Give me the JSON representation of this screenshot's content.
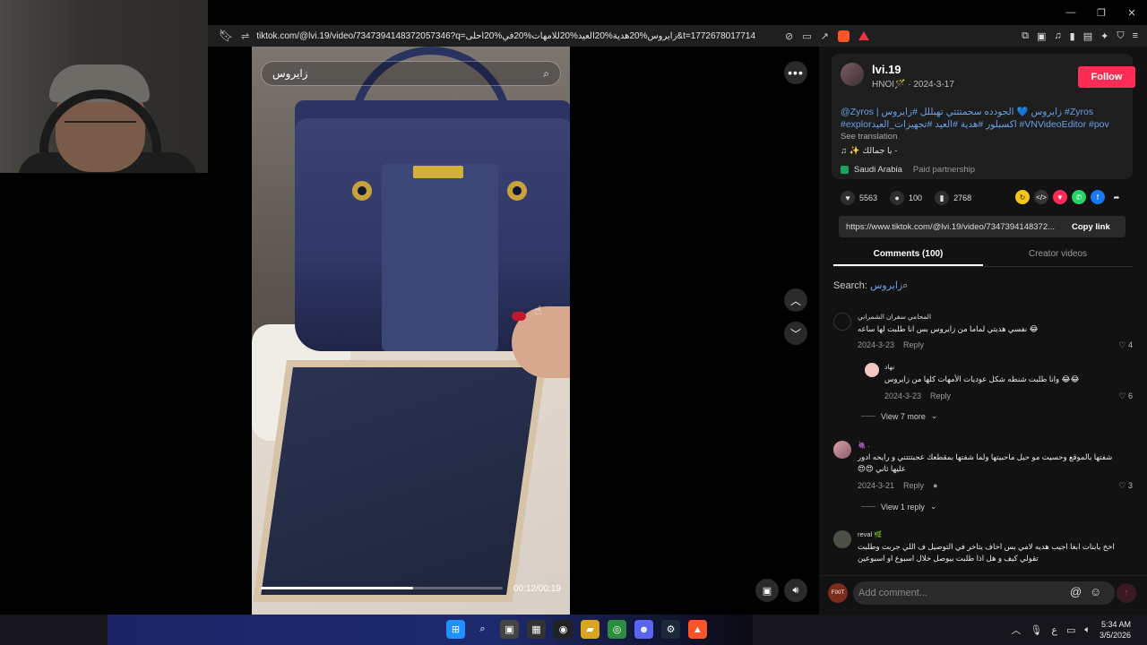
{
  "window": {
    "minimize": "—",
    "restore": "❐",
    "close": "✕"
  },
  "browser": {
    "url": "tiktok.com/@lvi.19/video/7347394148372057346?q=زايروس%20هدية%20العيد%20للامهات%20في%20احلى&t=1772678017714"
  },
  "video": {
    "search_query": "زايروس",
    "time_current": "00:12",
    "time_total": "00:19",
    "time_label": "00:12/00:19",
    "progress_fraction": 0.63
  },
  "author": {
    "username": "lvi.19",
    "subline": "HNOI🪄 · 2024-3-17",
    "follow_label": "Follow",
    "description": "@Zyros | زايروس 💙 الجودده سحمتتتي تهبللل #زايروس #Zyros #explorاكسبلور #هدية #العيد #تجهيزات_العيد #VNVideoEditor #pov",
    "see_translation": "See translation",
    "music": "♫ ✨ يا جمالك - ",
    "location": "Saudi Arabia",
    "paid": "Paid partnership"
  },
  "stats": {
    "likes": "5563",
    "comments": "100",
    "saves": "2768"
  },
  "share": {
    "link": "https://www.tiktok.com/@lvi.19/video/7347394148372...",
    "copy_label": "Copy link"
  },
  "tabs": {
    "comments": "Comments (100)",
    "creator_videos": "Creator videos"
  },
  "search": {
    "label": "Search: ",
    "term": "زايروس"
  },
  "comments": [
    {
      "name": "المحامي سفران الشمراني",
      "text": "😂 نفسي هديتي لماما من زايروس بس انا طلبت لها ساعه",
      "date": "2024-3-23",
      "reply": "Reply",
      "likes": "4"
    },
    {
      "name": "نهاد",
      "text": "😂😂 وانا طلبت شنطه شكل عوديات الأمهات كلها من زايروس",
      "date": "2024-3-23",
      "reply": "Reply",
      "likes": "6"
    },
    {
      "name": "🍇 .",
      "text": "شفتها بالموقع وحسيت مو حيل ماحبيتها ولما شفتها بمقطعك عجبتتتني و رايحه ادور عليها ثاني 😍😍",
      "date": "2024-3-21",
      "reply": "Reply",
      "likes": "3"
    },
    {
      "name": "reval 🌿",
      "text": "اخخ يابنات ابغا اجيب هديه لامي بس اخاف يتاخر في التوصيل ف اللي جربت وطلبت تقولي كيف و هل اذا طلبت بيوصل خلال اسبوع او اسبوعين",
      "date": "",
      "reply": "",
      "likes": ""
    }
  ],
  "view_more": {
    "first": "View 7 more",
    "second": "View 1 reply"
  },
  "add_comment": {
    "placeholder": "Add comment...",
    "avatar_text": "FIXIT"
  },
  "taskbar": {
    "time": "5:34 AM",
    "date": "3/5/2026",
    "lang": "ع"
  }
}
